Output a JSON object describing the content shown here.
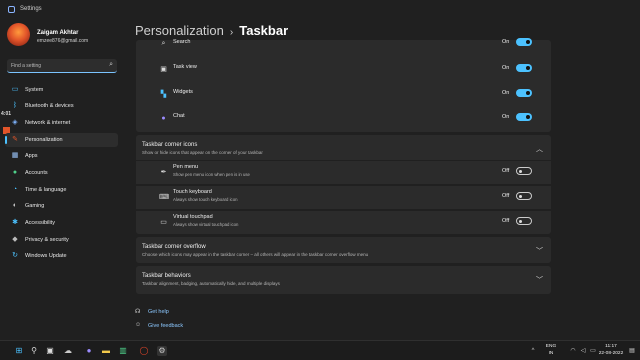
{
  "window": {
    "title": "Settings"
  },
  "user": {
    "name": "Zaigam Akhtar",
    "email": "emzee876@gmail.com"
  },
  "search": {
    "placeholder": "Find a setting"
  },
  "overlay_time": "4:01",
  "sidebar": {
    "items": [
      {
        "label": "System",
        "icon": "monitor-icon",
        "color": "#4cc2ff"
      },
      {
        "label": "Bluetooth & devices",
        "icon": "bluetooth-icon",
        "color": "#4cc2ff"
      },
      {
        "label": "Network & internet",
        "icon": "wifi-icon",
        "color": "#7fb5ff"
      },
      {
        "label": "Personalization",
        "icon": "brush-icon",
        "color": "#e2552a",
        "selected": true
      },
      {
        "label": "Apps",
        "icon": "apps-icon",
        "color": "#9ec9ff"
      },
      {
        "label": "Accounts",
        "icon": "person-icon",
        "color": "#4fd18b"
      },
      {
        "label": "Time & language",
        "icon": "globe-clock-icon",
        "color": "#4cc2ff"
      },
      {
        "label": "Gaming",
        "icon": "gamepad-icon",
        "color": "#cccccc"
      },
      {
        "label": "Accessibility",
        "icon": "accessibility-icon",
        "color": "#4cc2ff"
      },
      {
        "label": "Privacy & security",
        "icon": "shield-icon",
        "color": "#bbbbbb"
      },
      {
        "label": "Windows Update",
        "icon": "update-icon",
        "color": "#4cc2ff"
      }
    ]
  },
  "breadcrumb": {
    "parent": "Personalization",
    "separator": "›",
    "current": "Taskbar"
  },
  "taskbar_items": [
    {
      "label": "Search",
      "state": "On"
    },
    {
      "label": "Task view",
      "state": "On"
    },
    {
      "label": "Widgets",
      "state": "On"
    },
    {
      "label": "Chat",
      "state": "On"
    }
  ],
  "corner_icons": {
    "title": "Taskbar corner icons",
    "desc": "Show or hide icons that appear on the corner of your taskbar",
    "items": [
      {
        "label": "Pen menu",
        "desc": "Show pen menu icon when pen is in use",
        "state": "Off"
      },
      {
        "label": "Touch keyboard",
        "desc": "Always show touch keyboard icon",
        "state": "Off"
      },
      {
        "label": "Virtual touchpad",
        "desc": "Always show virtual touchpad icon",
        "state": "Off"
      }
    ]
  },
  "corner_overflow": {
    "title": "Taskbar corner overflow",
    "desc": "Choose which icons may appear in the taskbar corner – all others will appear in the taskbar corner overflow menu"
  },
  "behaviors": {
    "title": "Taskbar behaviors",
    "desc": "Taskbar alignment, badging, automatically hide, and multiple displays"
  },
  "links": {
    "help": "Get help",
    "feedback": "Give feedback"
  },
  "tray": {
    "lang1": "ENG",
    "lang2": "IN",
    "time": "11:17",
    "date": "22-08-2022"
  }
}
